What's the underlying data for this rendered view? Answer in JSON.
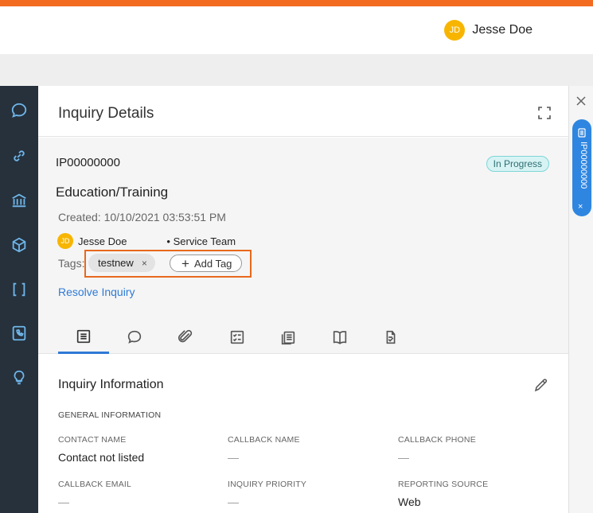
{
  "header": {
    "user_initials": "JD",
    "user_name": "Jesse Doe"
  },
  "sidenav": {
    "items": [
      {
        "icon": "chat-bubble-icon"
      },
      {
        "icon": "link-icon"
      },
      {
        "icon": "bank-icon"
      },
      {
        "icon": "cube-icon"
      },
      {
        "icon": "brackets-icon"
      },
      {
        "icon": "phone-book-icon"
      },
      {
        "icon": "lightbulb-icon"
      }
    ]
  },
  "inquiry": {
    "panel_title": "Inquiry Details",
    "ip_number": "IP00000000",
    "status": "In Progress",
    "subject": "Education/Training",
    "created": "Created: 10/10/2021 03:53:51 PM",
    "owner_initials": "JD",
    "owner_name": "Jesse Doe",
    "team": "• Service Team",
    "tags_label": "Tags:",
    "tags": [
      "testnew"
    ],
    "tag_remove": "×",
    "add_tag_icon": "+",
    "add_tag_label": "Add Tag",
    "resolve_label": "Resolve Inquiry"
  },
  "tabs": [
    {
      "icon": "details-icon",
      "active": true
    },
    {
      "icon": "chat-icon"
    },
    {
      "icon": "attachment-icon"
    },
    {
      "icon": "checklist-icon"
    },
    {
      "icon": "documents-icon"
    },
    {
      "icon": "knowledge-book-icon"
    },
    {
      "icon": "document-signature-icon"
    }
  ],
  "info": {
    "title": "Inquiry Information",
    "section": "GENERAL INFORMATION",
    "fields": [
      {
        "label": "CONTACT NAME",
        "value": "Contact not listed"
      },
      {
        "label": "CALLBACK NAME",
        "value": "—"
      },
      {
        "label": "CALLBACK PHONE",
        "value": "—"
      },
      {
        "label": "CALLBACK EMAIL",
        "value": "—"
      },
      {
        "label": "INQUIRY PRIORITY",
        "value": "—"
      },
      {
        "label": "REPORTING SOURCE",
        "value": "Web"
      }
    ]
  },
  "rail": {
    "pill_text": "IP00000000",
    "pill_close": "×"
  },
  "colors": {
    "accent_orange": "#f26b21",
    "sidenav_bg": "#26313c",
    "link_blue": "#2f7ad6",
    "avatar_yellow": "#f7b500",
    "status_bg": "#d7f3f4"
  }
}
